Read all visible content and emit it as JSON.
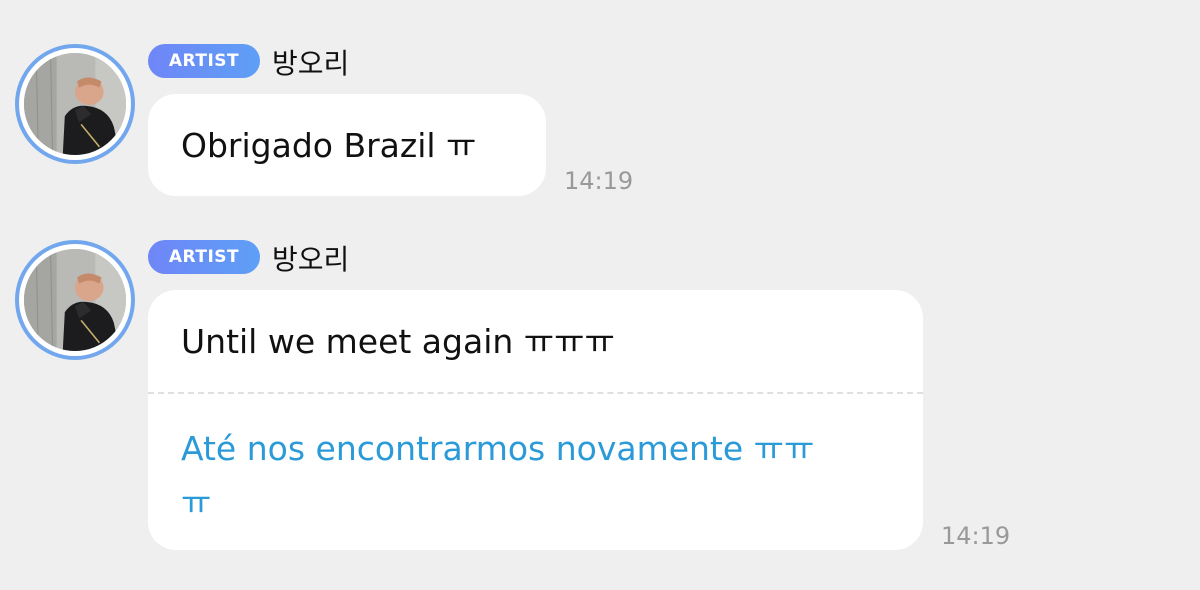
{
  "messages": [
    {
      "badge": "ARTIST",
      "sender": "방오리",
      "text": "Obrigado Brazil ㅠ",
      "time": "14:19"
    },
    {
      "badge": "ARTIST",
      "sender": "방오리",
      "text": "Until we meet again ㅠㅠㅠ",
      "translation_line1": "Até nos encontrarmos novamente ㅠㅠ",
      "translation_line2": "ㅠ",
      "time": "14:19"
    }
  ],
  "colors": {
    "background": "#efefef",
    "bubble": "#ffffff",
    "badge_gradient_start": "#6f86f7",
    "badge_gradient_end": "#5e9ff6",
    "avatar_ring": "#72a7ee",
    "translation_text": "#2b9ad8",
    "timestamp": "#999999"
  },
  "icons": {
    "avatar": "profile-photo"
  }
}
